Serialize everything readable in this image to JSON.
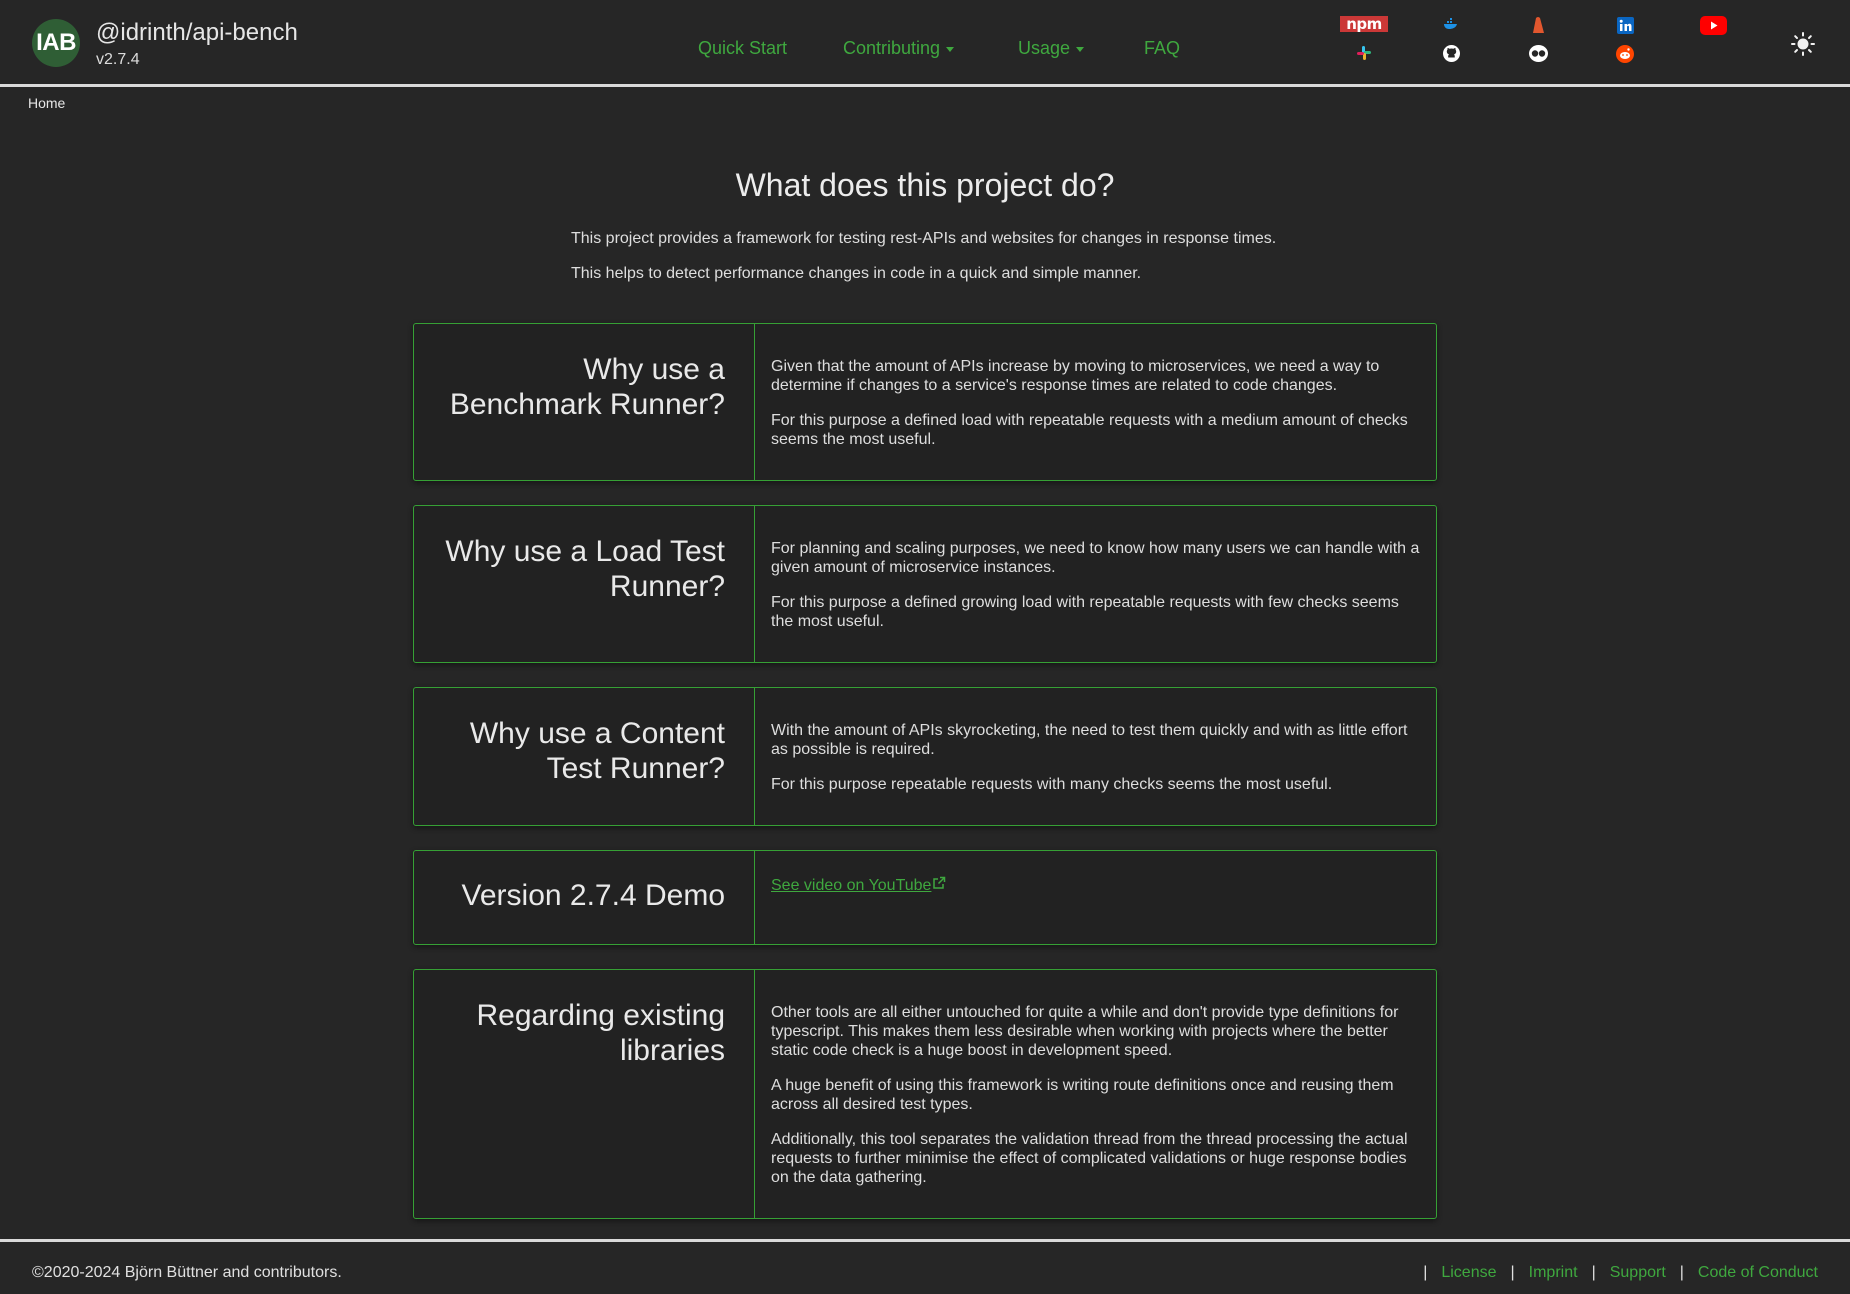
{
  "header": {
    "logo_text": "IAB",
    "brand_name": "@idrinth/api-bench",
    "version": "v2.7.4",
    "nav": [
      {
        "label": "Quick Start",
        "dropdown": false
      },
      {
        "label": "Contributing",
        "dropdown": true
      },
      {
        "label": "Usage",
        "dropdown": true
      },
      {
        "label": "FAQ",
        "dropdown": false
      }
    ],
    "npm_label": "npm",
    "social_icons": [
      "npm-icon",
      "docker-icon",
      "gitlab-icon",
      "linkedin-icon",
      "youtube-icon",
      "slack-icon",
      "github-icon",
      "disqus-icon",
      "reddit-icon"
    ],
    "theme_toggle_icon": "sun-icon"
  },
  "breadcrumb": "Home",
  "intro": {
    "title": "What does this project do?",
    "line1": "This project provides a framework for testing rest-APIs and websites for changes in response times.",
    "line2": "This helps to detect performance changes in code in a quick and simple manner."
  },
  "cards": [
    {
      "heading": "Why use a Benchmark Runner?",
      "paragraphs": [
        "Given that the amount of APIs increase by moving to microservices, we need a way to determine if changes to a service's response times are related to code changes.",
        "For this purpose a defined load with repeatable requests with a medium amount of checks seems the most useful."
      ]
    },
    {
      "heading": "Why use a Load Test Runner?",
      "paragraphs": [
        "For planning and scaling purposes, we need to know how many users we can handle with a given amount of microservice instances.",
        "For this purpose a defined growing load with repeatable requests with few checks seems the most useful."
      ]
    },
    {
      "heading": "Why use a Content Test Runner?",
      "paragraphs": [
        "With the amount of APIs skyrocketing, the need to test them quickly and with as little effort as possible is required.",
        "For this purpose repeatable requests with many checks seems the most useful."
      ]
    },
    {
      "heading": "Version 2.7.4 Demo",
      "link_text": "See video on YouTube"
    },
    {
      "heading": "Regarding existing libraries",
      "paragraphs": [
        "Other tools are all either untouched for quite a while and don't provide type definitions for typescript. This makes them less desirable when working with projects where the better static code check is a huge boost in development speed.",
        "A huge benefit of using this framework is writing route definitions once and reusing them across all desired test types.",
        "Additionally, this tool separates the validation thread from the thread processing the actual requests to further minimise the effect of complicated validations or huge response bodies on the data gathering."
      ]
    }
  ],
  "footer": {
    "copyright": "©2020-2024 Björn Büttner and contributors.",
    "links": [
      "License",
      "Imprint",
      "Support",
      "Code of Conduct"
    ],
    "separator": "|"
  },
  "colors": {
    "background": "#262626",
    "accent_green": "#3fa83f",
    "card_border": "#36a035",
    "logo_bg": "#2f5e35"
  }
}
